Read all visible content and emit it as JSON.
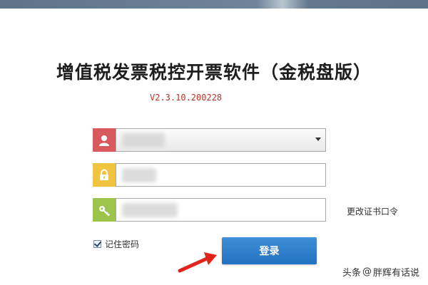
{
  "app": {
    "title": "增值税发票税控开票软件（金税盘版）",
    "version": "V2.3.10.200228"
  },
  "login_form": {
    "username": {
      "icon": "user-icon",
      "value": "",
      "color": "#d85a5f"
    },
    "password": {
      "icon": "lock-icon",
      "value": "",
      "color": "#f0c43e"
    },
    "cert_password": {
      "icon": "key-icon",
      "value": "",
      "color": "#9cc34a"
    },
    "change_cert_password_label": "更改证书口令",
    "remember_password_label": "记住密码",
    "remember_password_checked": true,
    "login_button_label": "登录",
    "login_button_color": "#2a7ac9"
  },
  "watermark": {
    "source": "头条",
    "at": "@",
    "author": "胖辉有话说"
  }
}
